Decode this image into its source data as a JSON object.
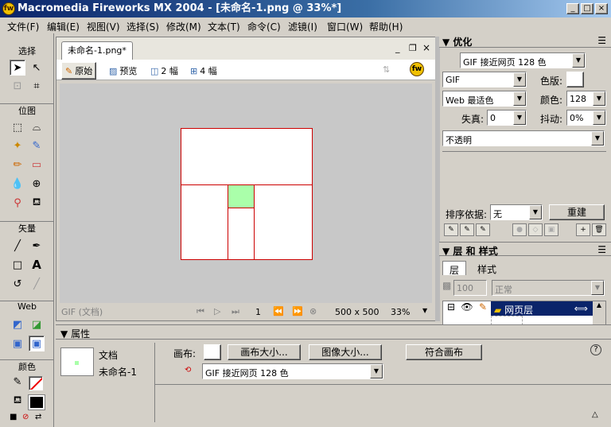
{
  "window": {
    "title": "Macromedia Fireworks MX 2004 - [未命名-1.png @  33%*]",
    "min": "_",
    "max": "□",
    "close": "×"
  },
  "menu": [
    "文件(F)",
    "编辑(E)",
    "视图(V)",
    "选择(S)",
    "修改(M)",
    "文本(T)",
    "命令(C)",
    "滤镜(I)",
    "窗口(W)",
    "帮助(H)"
  ],
  "toolbox": {
    "select": "选择",
    "bitmap": "位图",
    "vector": "矢量",
    "web": "Web",
    "colors": "颜色"
  },
  "doc": {
    "tab_title": "未命名-1.png*",
    "views": [
      "原始",
      "预览",
      "2 幅",
      "4 幅"
    ],
    "status_format": "GIF (文档)",
    "frame": "1",
    "size": "500 x 500",
    "zoom": "33%"
  },
  "optimize": {
    "title": "优化",
    "preset": "GIF 接近网页 128 色",
    "format": "GIF",
    "palette": "Web 最适色",
    "matte_label": "色版:",
    "colors_label": "颜色:",
    "colors": "128",
    "loss_label": "失真:",
    "loss": "0",
    "dither_label": "抖动:",
    "dither": "0%",
    "transparency": "不透明",
    "sort_label": "排序依据:",
    "sort": "无",
    "rebuild": "重建"
  },
  "layers": {
    "title": "层 和 样式",
    "tabs": [
      "层",
      "样式"
    ],
    "opacity": "100",
    "blend": "正常",
    "web_layer": "网页层"
  },
  "props": {
    "title": "属性",
    "doc_label": "文档",
    "doc_name": "未命名-1",
    "canvas_label": "画布:",
    "canvas_size_btn": "画布大小...",
    "image_size_btn": "图像大小...",
    "fit_canvas_btn": "符合画布",
    "export_preset": "GIF 接近网页 128 色",
    "help": "?"
  },
  "colors": {
    "slice_green": "#aaffaa",
    "slice_border": "#cc0000",
    "title_dark": "#0a246a"
  }
}
